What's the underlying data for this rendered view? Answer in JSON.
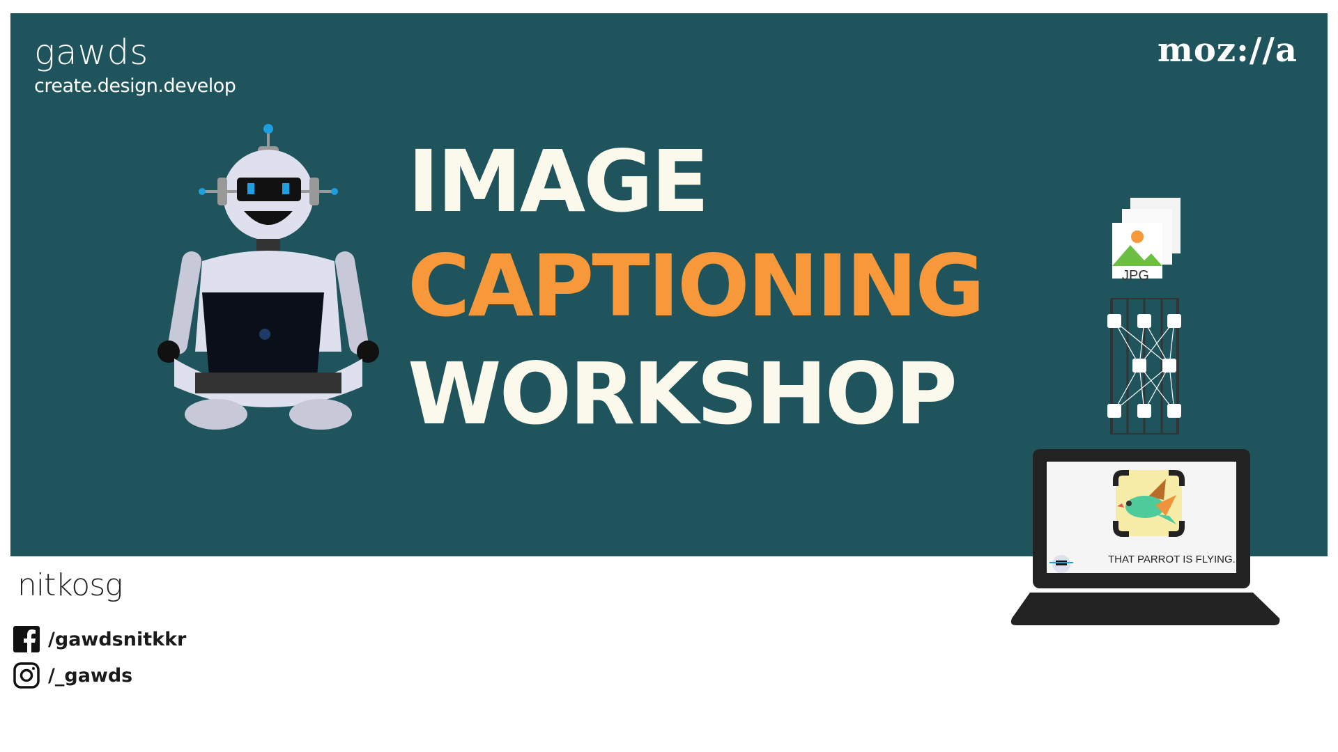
{
  "header": {
    "brand": "gawds",
    "tagline": "create.design.develop",
    "partner": "moz://a"
  },
  "title": {
    "line1": "IMAGE",
    "line2": "CAPTIONING",
    "line3": "WORKSHOP"
  },
  "illustration": {
    "file_label": "JPG",
    "caption": "THAT PARROT IS FLYING."
  },
  "footer": {
    "org": "nitkosg",
    "socials": [
      {
        "icon": "facebook-icon",
        "handle": "/gawdsnitkkr"
      },
      {
        "icon": "instagram-icon",
        "handle": "/_gawds"
      }
    ]
  },
  "colors": {
    "panel": "#20545c",
    "accent": "#f7993a",
    "text": "#fbf8ec"
  }
}
